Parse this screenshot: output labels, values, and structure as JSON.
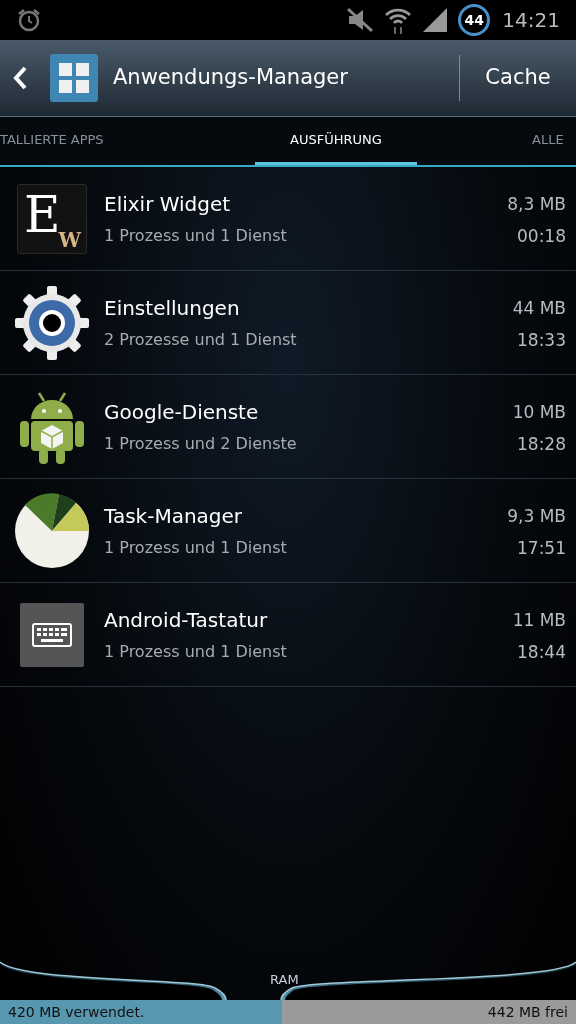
{
  "status_bar": {
    "battery": "44",
    "time": "14:21"
  },
  "header": {
    "title": "Anwendungs-Manager",
    "action": "Cache"
  },
  "tabs": [
    {
      "label": "TALLIERTE APPS",
      "selected": false
    },
    {
      "label": "AUSFÜHRUNG",
      "selected": true
    },
    {
      "label": "ALLE",
      "selected": false
    }
  ],
  "apps": [
    {
      "kind": "elixir",
      "logo_letters": [
        "E",
        "W"
      ],
      "name": "Elixir Widget",
      "detail": "1 Prozess und 1 Dienst",
      "size": "8,3 MB",
      "time": "00:18"
    },
    {
      "kind": "gear",
      "name": "Einstellungen",
      "detail": "2 Prozesse und 1 Dienst",
      "size": "44 MB",
      "time": "18:33"
    },
    {
      "kind": "android",
      "name": "Google-Dienste",
      "detail": "1 Prozess und 2 Dienste",
      "size": "10 MB",
      "time": "18:28"
    },
    {
      "kind": "pie",
      "name": "Task-Manager",
      "detail": "1 Prozess und 1 Dienst",
      "size": "9,3 MB",
      "time": "17:51"
    },
    {
      "kind": "keyboard",
      "name": "Android-Tastatur",
      "detail": "1 Prozess und 1 Dienst",
      "size": "11 MB",
      "time": "18:44"
    }
  ],
  "ram": {
    "label": "RAM",
    "used": "420 MB verwendet.",
    "free": "442 MB frei",
    "level": 0.49
  }
}
